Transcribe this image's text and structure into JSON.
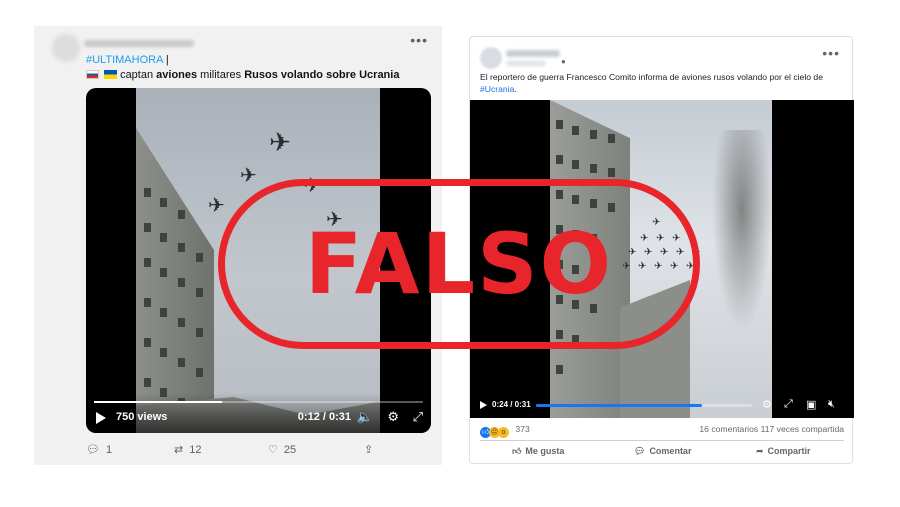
{
  "tweet": {
    "hashtag": "#ULTIMAHORA",
    "hashtag_suffix": " |",
    "line2_prefix": "captan ",
    "line2_bold1": "aviones",
    "line2_mid": " militares ",
    "line2_bold2": "Rusos volando sobre Ucrania",
    "video": {
      "views": "750 views",
      "time": "0:12 / 0:31",
      "progress_fraction": 0.39
    },
    "actions": {
      "replies": "1",
      "retweets": "12",
      "likes": "25"
    }
  },
  "facebook_post": {
    "text": "El reportero de guerra Francesco Comito informa de aviones rusos volando por el cielo de ",
    "hashtag": "#Ucrania",
    "hashtag_suffix": ".",
    "video": {
      "time": "0:24 / 0:31",
      "progress_fraction": 0.77
    },
    "reactions_count": "373",
    "comments": "16 comentarios",
    "shares": "117 veces compartida",
    "actions": {
      "like": "Me gusta",
      "comment": "Comentar",
      "share": "Compartir"
    }
  },
  "stamp": {
    "label": "FALSO",
    "color": "#e8252a"
  },
  "colors": {
    "twitter_link": "#1d9bf0",
    "facebook_blue": "#1877f2"
  }
}
